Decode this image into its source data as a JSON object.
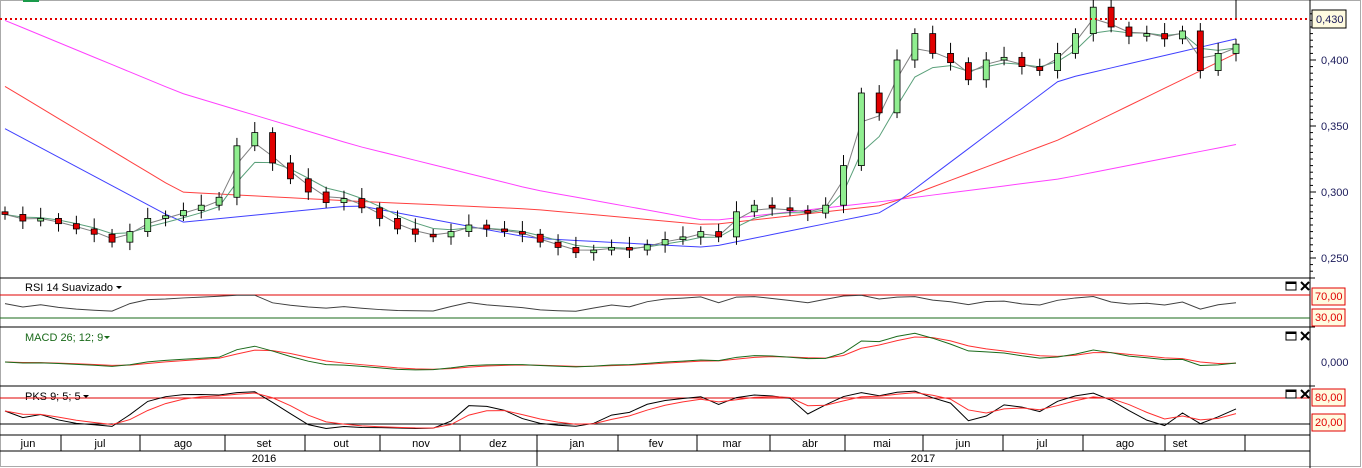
{
  "panels": {
    "rsi": {
      "title": "RSI 14 Suavizado",
      "levels": [
        "70,00",
        "30,00"
      ]
    },
    "macd": {
      "title": "MACD 26; 12; 9",
      "zero": "0,000"
    },
    "pks": {
      "title": "PKS 9; 5; 5",
      "levels": [
        "80,00",
        "20,00"
      ]
    }
  },
  "current_price_label": "0,430",
  "price_ticks": [
    "0,400",
    "0,350",
    "0,300",
    "0,250"
  ],
  "months": [
    "jun",
    "jul",
    "ago",
    "set",
    "out",
    "nov",
    "dez",
    "jan",
    "fev",
    "mar",
    "abr",
    "mai",
    "jun",
    "jul",
    "ago",
    "set"
  ],
  "years": [
    "2016",
    "2017"
  ],
  "colors": {
    "up": "#90ee90",
    "down": "#e00000",
    "ma_fast": "#808080",
    "ma_green": "#5aa07a",
    "ma_blue": "#4040ff",
    "ma_red": "#ff4040",
    "ma_magenta": "#ff40ff"
  },
  "chart_data": {
    "type": "candlestick",
    "ylim": [
      0.235,
      0.445
    ],
    "current_price": 0.43,
    "closes": [
      0.283,
      0.278,
      0.28,
      0.276,
      0.272,
      0.268,
      0.262,
      0.27,
      0.28,
      0.282,
      0.286,
      0.29,
      0.296,
      0.335,
      0.345,
      0.322,
      0.31,
      0.3,
      0.292,
      0.295,
      0.288,
      0.28,
      0.272,
      0.268,
      0.266,
      0.27,
      0.275,
      0.272,
      0.27,
      0.268,
      0.262,
      0.258,
      0.254,
      0.256,
      0.258,
      0.256,
      0.26,
      0.264,
      0.266,
      0.27,
      0.266,
      0.285,
      0.29,
      0.288,
      0.286,
      0.284,
      0.29,
      0.32,
      0.375,
      0.36,
      0.4,
      0.42,
      0.405,
      0.398,
      0.385,
      0.4,
      0.402,
      0.395,
      0.392,
      0.405,
      0.42,
      0.44,
      0.425,
      0.418,
      0.42,
      0.416,
      0.422,
      0.392,
      0.405,
      0.412
    ],
    "ma_blue": [
      0.348,
      0.277,
      0.29,
      0.265,
      0.258,
      0.285,
      0.385,
      0.416
    ],
    "ma_red": [
      0.38,
      0.3,
      0.293,
      0.287,
      0.275,
      0.29,
      0.34,
      0.405
    ],
    "ma_magenta": [
      0.43,
      0.375,
      0.335,
      0.302,
      0.278,
      0.293,
      0.31,
      0.336
    ],
    "rsi_levels": [
      70,
      30
    ],
    "pks_levels": [
      80,
      20
    ]
  }
}
